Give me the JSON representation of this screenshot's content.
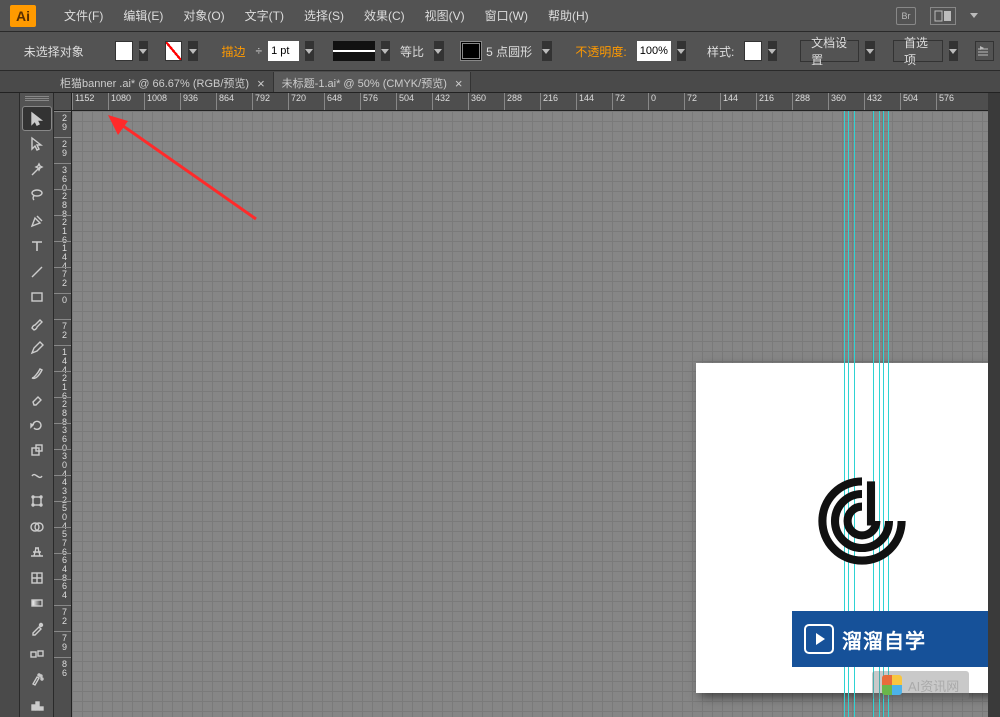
{
  "logo": "Ai",
  "menu": [
    "文件(F)",
    "编辑(E)",
    "对象(O)",
    "文字(T)",
    "选择(S)",
    "效果(C)",
    "视图(V)",
    "窗口(W)",
    "帮助(H)"
  ],
  "menubar_right": {
    "label1": "Br"
  },
  "control": {
    "no_selection": "未选择对象",
    "stroke_label": "描边",
    "stroke_value": "1 pt",
    "ratio_label": "等比",
    "round_label": "5 点圆形",
    "opacity_label": "不透明度:",
    "opacity_value": "100%",
    "style_label": "样式:",
    "doc_setup": "文档设置",
    "prefs": "首选项"
  },
  "tabs": [
    {
      "label": "柜猫banner .ai* @ 66.67% (RGB/预览)",
      "close": "×"
    },
    {
      "label": "未标题-1.ai* @ 50% (CMYK/预览)",
      "close": "×"
    }
  ],
  "ruler_h": [
    "1152",
    "1080",
    "1008",
    "936",
    "864",
    "792",
    "720",
    "648",
    "576",
    "504",
    "432",
    "360",
    "288",
    "216",
    "144",
    "72",
    "0",
    "72",
    "144",
    "216",
    "288",
    "360",
    "432",
    "504",
    "576"
  ],
  "ruler_v": [
    [
      "2",
      "9"
    ],
    [
      "2",
      "9"
    ],
    [
      "3",
      "6",
      "0"
    ],
    [
      "2",
      "8",
      "8"
    ],
    [
      "2",
      "1",
      "6"
    ],
    [
      "1",
      "4",
      "4"
    ],
    [
      "7",
      "2"
    ],
    [
      "0"
    ],
    [
      "7",
      "2"
    ],
    [
      "1",
      "4",
      "4"
    ],
    [
      "2",
      "1",
      "6"
    ],
    [
      "2",
      "8",
      "8"
    ],
    [
      "3",
      "6",
      "0"
    ],
    [
      "3",
      "0",
      "4"
    ],
    [
      "4",
      "3",
      "2"
    ],
    [
      "5",
      "0",
      "4"
    ],
    [
      "5",
      "7",
      "6"
    ],
    [
      "6",
      "4",
      "8"
    ],
    [
      "6",
      "4"
    ],
    [
      "7",
      "2"
    ],
    [
      "7",
      "9"
    ],
    [
      "8",
      "6"
    ]
  ],
  "watermark": {
    "text": "溜溜自学",
    "sub": "AI资讯网"
  }
}
